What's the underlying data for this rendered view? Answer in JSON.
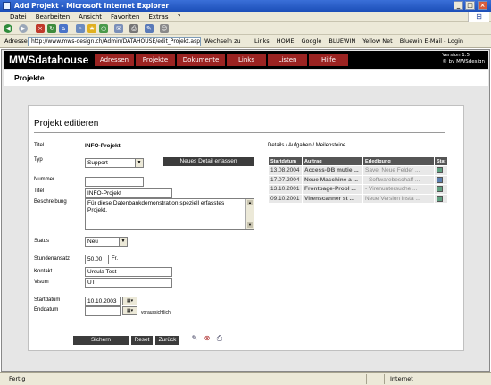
{
  "window": {
    "title": "Add Projekt - Microsoft Internet Explorer",
    "min": "_",
    "max": "□",
    "close": "×"
  },
  "menu": [
    "Datei",
    "Bearbeiten",
    "Ansicht",
    "Favoriten",
    "Extras",
    "?"
  ],
  "address": {
    "label": "Adresse",
    "url": "http://www.mws-design.ch/Admin/DATAHOUSE/edit_Projekt.asp?",
    "go": "Wechseln zu",
    "links_label": "Links",
    "links": [
      "HOME",
      "Google",
      "BLUEWIN",
      "Yellow Net",
      "Bluewin E-Mail - Login"
    ]
  },
  "app": {
    "brand": "MWSdatahouse",
    "version": "Version 1.5",
    "copyright": "© by MWSdesign",
    "nav": [
      "Adressen",
      "Projekte",
      "Dokumente",
      "Links",
      "Listen",
      "Hilfe"
    ]
  },
  "page": {
    "section": "Projekte",
    "heading": "Projekt editieren"
  },
  "form": {
    "titel_label": "Titel",
    "titel_value": "INFO-Projekt",
    "typ_label": "Typ",
    "typ_value": "Support",
    "detail_button": "Neues Detail erfassen",
    "nummer_label": "Nummer",
    "nummer_value": "",
    "titel2_label": "Titel",
    "titel2_value": "INFO-Projekt",
    "beschreibung_label": "Beschreibung",
    "beschreibung_value": "Für diese Datenbankdemonstration speziell erfasstes Projekt.",
    "status_label": "Status",
    "status_value": "Neu",
    "stundenansatz_label": "Stundenansatz",
    "stundenansatz_value": "50.00",
    "currency": "Fr.",
    "kontakt_label": "Kontakt",
    "kontakt_value": "Ursula Test",
    "visum_label": "Visum",
    "visum_value": "UT",
    "startdatum_label": "Startdatum",
    "startdatum_value": "10.10.2003",
    "enddatum_label": "Enddatum",
    "enddatum_value": "",
    "enddatum_hint": "voraussichtlich",
    "save_button": "Sichern",
    "reset_button": "Reset",
    "back_button": "Zurück"
  },
  "details": {
    "title": "Details / Aufgaben / Meilensteine",
    "columns": [
      "Startdatum",
      "Auftrag",
      "Erledigung",
      "Stat"
    ],
    "rows": [
      {
        "date": "13.08.2004",
        "auftrag": "Access-DB mutie ...",
        "erledigung": "Save, Neue Felder ...",
        "status_color": "#5fa080"
      },
      {
        "date": "17.07.2004",
        "auftrag": "Neue Maschine a ...",
        "erledigung": "- Softwarebeschaff ...",
        "status_color": "#5c7fb0"
      },
      {
        "date": "13.10.2001",
        "auftrag": "Frontpage-Probl ...",
        "erledigung": "- Virenuntersuche ...",
        "status_color": "#5fa080"
      },
      {
        "date": "09.10.2001",
        "auftrag": "Virenscanner st ...",
        "erledigung": "Neue Version insta ...",
        "status_color": "#5fa080"
      }
    ]
  },
  "statusbar": {
    "left": "Fertig",
    "zone": "Internet"
  }
}
